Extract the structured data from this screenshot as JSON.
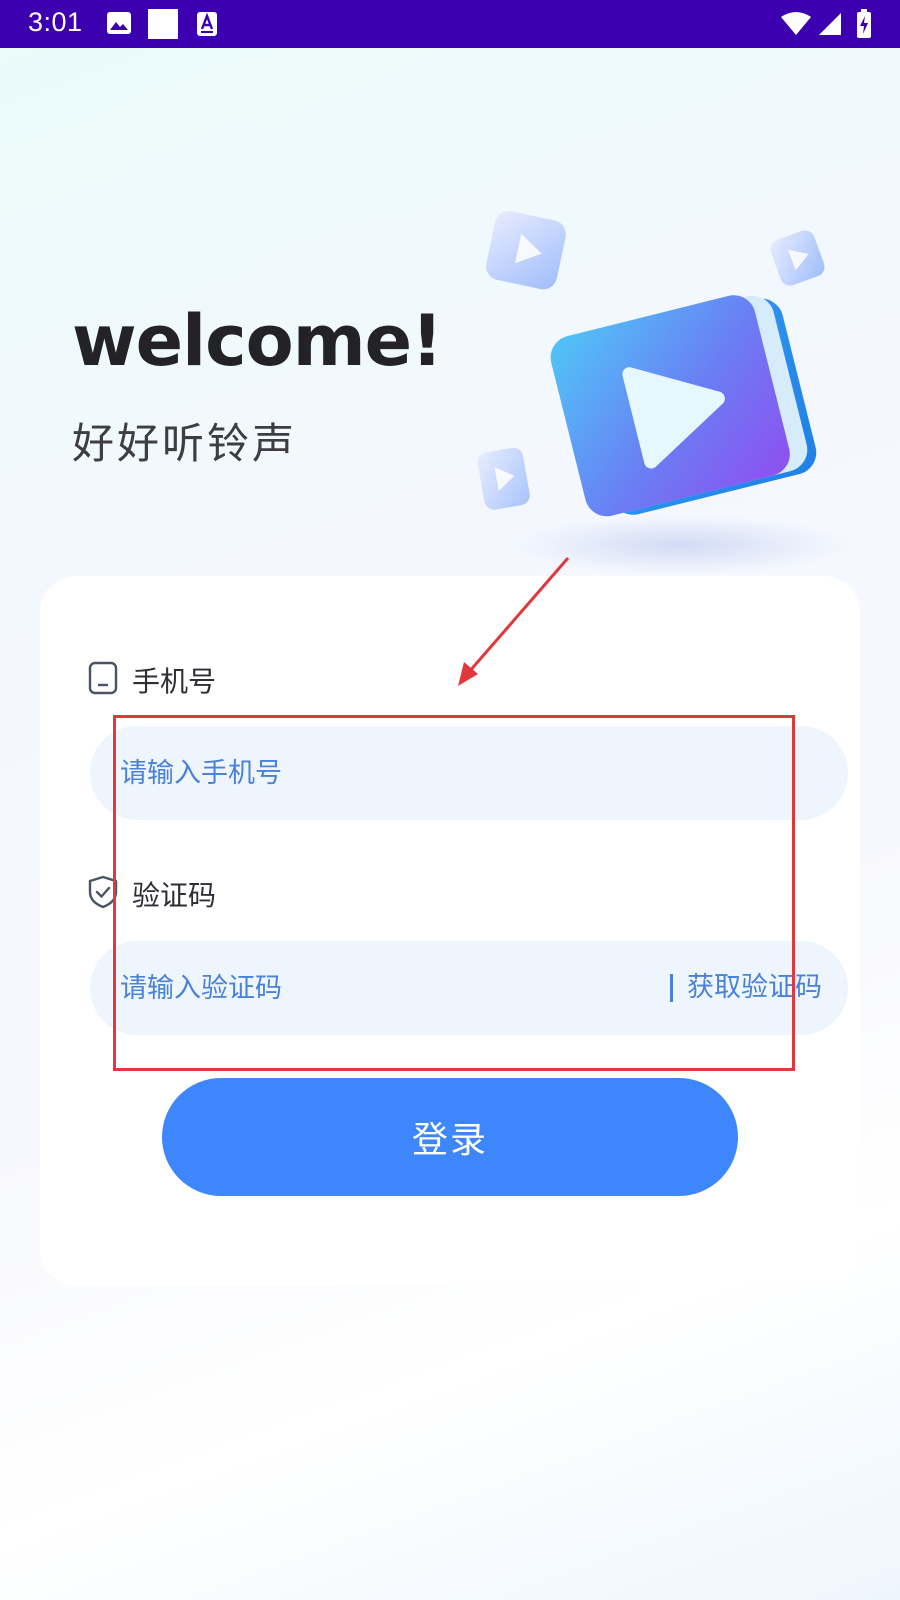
{
  "status_bar": {
    "time": "3:01",
    "icons": [
      "gallery-icon",
      "square-notification-icon",
      "font-download-icon",
      "wifi-icon",
      "cell-signal-icon",
      "battery-charging-icon"
    ],
    "background": "#3c00b0"
  },
  "hero": {
    "welcome": "welcome!",
    "app_name": "好好听铃声",
    "illustration": "video-play-illustration"
  },
  "form": {
    "phone": {
      "label": "手机号",
      "icon": "phone-icon",
      "placeholder": "请输入手机号"
    },
    "code": {
      "label": "验证码",
      "icon": "shield-check-icon",
      "placeholder": "请输入验证码",
      "get_code_label": "获取验证码"
    },
    "login_label": "登录"
  },
  "colors": {
    "accent": "#3d86fc",
    "input_bg": "#eef5fd",
    "input_text": "#4a82d8",
    "annotation": "#e0383c"
  }
}
